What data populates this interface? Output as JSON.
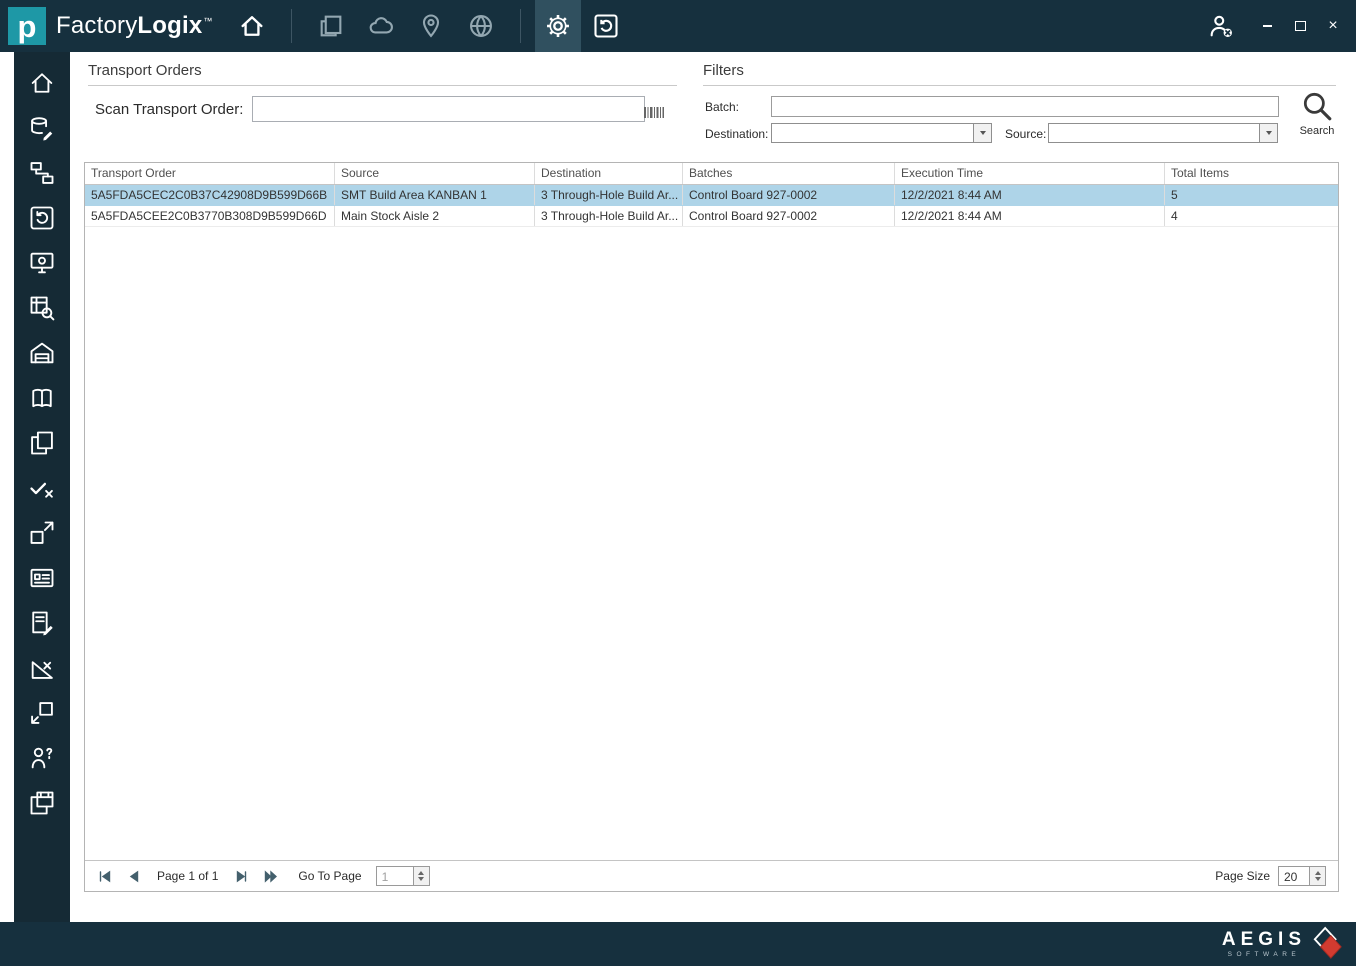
{
  "titlebar": {
    "logo_letter": "p",
    "app_name": "Factory",
    "app_name_bold": "Logix",
    "trademark": "™",
    "icons": [
      "home",
      "pages",
      "network",
      "location-pin",
      "globe",
      "settings-gear",
      "history",
      "user-logout",
      "minimize",
      "maximize",
      "close"
    ]
  },
  "sidebar": {
    "icons": [
      "home",
      "database-edit",
      "process-flow",
      "history",
      "workstation",
      "table-search",
      "warehouse",
      "documentation",
      "copy",
      "verify",
      "material-transfer",
      "id-card",
      "document-edit",
      "measure",
      "receive",
      "operator-question",
      "schedule-copy"
    ]
  },
  "panel": {
    "transport_orders_title": "Transport Orders",
    "scan_label": "Scan Transport Order:",
    "scan_value": "",
    "filters_title": "Filters",
    "batch_label": "Batch:",
    "batch_value": "",
    "destination_label": "Destination:",
    "destination_value": "",
    "source_label": "Source:",
    "source_value": "",
    "search_label": "Search"
  },
  "table": {
    "columns": [
      "Transport Order",
      "Source",
      "Destination",
      "Batches",
      "Execution Time",
      "Total Items"
    ],
    "rows": [
      {
        "transport_order": "5A5FDA5CEC2C0B37C42908D9B599D66B",
        "source": "SMT Build Area KANBAN 1",
        "destination": "3 Through-Hole Build Ar...",
        "batches": "Control Board 927-0002",
        "execution_time": "12/2/2021 8:44 AM",
        "total_items": "5",
        "selected": true
      },
      {
        "transport_order": "5A5FDA5CEE2C0B3770B308D9B599D66D",
        "source": "Main Stock Aisle 2",
        "destination": "3 Through-Hole Build Ar...",
        "batches": "Control Board 927-0002",
        "execution_time": "12/2/2021 8:44 AM",
        "total_items": "4",
        "selected": false
      }
    ]
  },
  "pagination": {
    "page_text": "Page 1 of 1",
    "goto_label": "Go To Page",
    "goto_value": "1",
    "page_size_label": "Page Size",
    "page_size_value": "20"
  },
  "footer": {
    "brand": "AEGIS",
    "tagline": "SOFTWARE"
  },
  "colors": {
    "titlebar_bg": "#16303e",
    "sidebar_bg": "#152a35",
    "accent_teal": "#1e98a6",
    "selected_row": "#aed4e8",
    "logo_diamond_red": "#d23b30"
  }
}
